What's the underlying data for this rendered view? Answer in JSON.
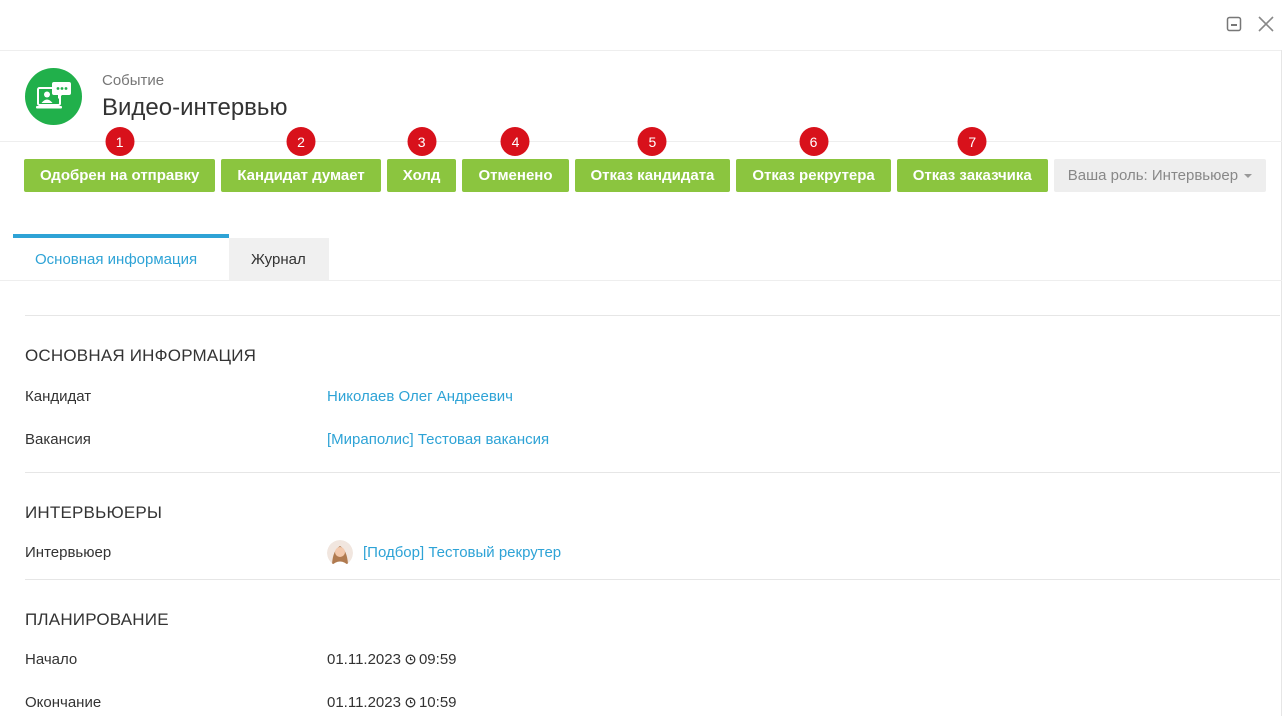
{
  "header": {
    "event_type": "Событие",
    "title": "Видео-интервью"
  },
  "colors": {
    "accent_green": "#8bc53f",
    "badge_red": "#d8111b",
    "link_blue": "#2ea3d6",
    "avatar_green": "#21b04b"
  },
  "actions": [
    {
      "badge": "1",
      "label": "Одобрен на отправку"
    },
    {
      "badge": "2",
      "label": "Кандидат думает"
    },
    {
      "badge": "3",
      "label": "Холд"
    },
    {
      "badge": "4",
      "label": "Отменено"
    },
    {
      "badge": "5",
      "label": "Отказ кандидата"
    },
    {
      "badge": "6",
      "label": "Отказ рекрутера"
    },
    {
      "badge": "7",
      "label": "Отказ заказчика"
    }
  ],
  "role": {
    "label": "Ваша роль: Интервьюер"
  },
  "tabs": [
    {
      "label": "Основная информация"
    },
    {
      "label": "Журнал"
    }
  ],
  "sections": {
    "main": {
      "title": "ОСНОВНАЯ ИНФОРМАЦИЯ",
      "candidate_label": "Кандидат",
      "candidate_value": "Николаев Олег Андреевич",
      "vacancy_label": "Вакансия",
      "vacancy_value": "[Мираполис] Тестовая вакансия"
    },
    "interviewers": {
      "title": "ИНТЕРВЬЮЕРЫ",
      "interviewer_label": "Интервьюер",
      "interviewer_value": "[Подбор] Тестовый рекрутер"
    },
    "planning": {
      "title": "ПЛАНИРОВАНИЕ",
      "start_label": "Начало",
      "start_date": "01.11.2023",
      "start_time": "09:59",
      "end_label": "Окончание",
      "end_date": "01.11.2023",
      "end_time": "10:59"
    }
  },
  "icons": {
    "minimize": "minimize-icon",
    "close": "close-icon",
    "event": "video-interview-icon",
    "clock": "clock-icon"
  }
}
